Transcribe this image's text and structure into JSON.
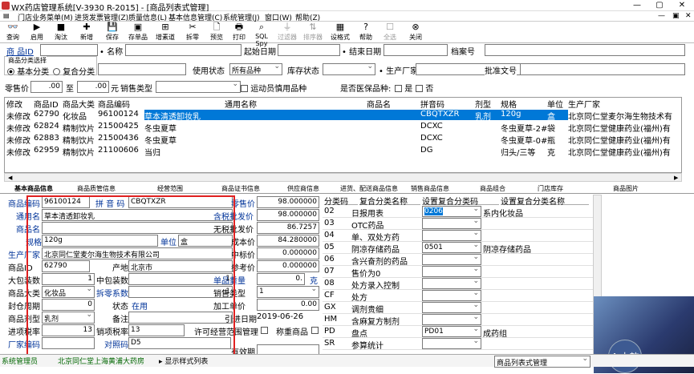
{
  "window": {
    "title": "WX药店管理系统[V-3930 R-2015] - [商品列表式管理]",
    "controls": [
      "—",
      "▢",
      "✕"
    ]
  },
  "menu": [
    "门店业务菜单(M)",
    "进货发票管理(Z)",
    "质量信息(L)",
    "基本信息管理(C)",
    "系统管理(J)",
    "窗口(W)",
    "帮助(Z)"
  ],
  "toolbar": [
    {
      "label": "查询",
      "icon": "binoculars-icon",
      "glyph": "👓",
      "enabled": true
    },
    {
      "label": "启用",
      "icon": "play-icon",
      "glyph": "▶",
      "enabled": true
    },
    {
      "label": "淘汰",
      "icon": "stop-icon",
      "glyph": "■",
      "enabled": true
    },
    {
      "label": "新增",
      "icon": "add-icon",
      "glyph": "✚",
      "enabled": true
    },
    {
      "label": "保存",
      "icon": "save-icon",
      "glyph": "💾",
      "enabled": true
    },
    {
      "label": "存单品",
      "icon": "save-item-icon",
      "glyph": "▣",
      "enabled": true
    },
    {
      "label": "增素道",
      "icon": "add-channel-icon",
      "glyph": "⊞",
      "enabled": true
    },
    {
      "label": "拆零",
      "icon": "split-icon",
      "glyph": "✂",
      "enabled": true
    },
    {
      "label": "预览",
      "icon": "preview-icon",
      "glyph": "🗋",
      "enabled": true
    },
    {
      "label": "打印",
      "icon": "print-icon",
      "glyph": "🖶",
      "enabled": true
    },
    {
      "label": "SQL Spy",
      "icon": "sql-icon",
      "glyph": "⌕",
      "enabled": true
    },
    {
      "label": "过滤器",
      "icon": "filter-icon",
      "glyph": "⏚",
      "enabled": false
    },
    {
      "label": "排序器",
      "icon": "sort-icon",
      "glyph": "⇅",
      "enabled": false
    },
    {
      "label": "设格式",
      "icon": "format-icon",
      "glyph": "▦",
      "enabled": true
    },
    {
      "label": "帮助",
      "icon": "help-icon",
      "glyph": "?",
      "enabled": true
    },
    {
      "label": "全选",
      "icon": "select-all-icon",
      "glyph": "☐",
      "enabled": false
    },
    {
      "label": "关闭",
      "icon": "close-icon",
      "glyph": "⊗",
      "enabled": true
    }
  ],
  "filters": {
    "product_id_label": "商  品ID",
    "name_label": "名称",
    "start_date_label": "起始日期",
    "end_date_label": "结束日期",
    "archive_label": "档案号",
    "category_group_label": "商品分类选择",
    "basic_cat_label": "基本分类",
    "compound_cat_label": "复合分类",
    "use_status_label": "使用状态",
    "use_status_value": "所有品种",
    "stock_status_label": "库存状态",
    "manufacturer_label": "生产厂家",
    "approval_label": "批准文号",
    "retail_label": "零售价",
    "retail_from": ".00",
    "to_label": "至",
    "retail_to": ".00",
    "yuan_label": "元",
    "sales_type_label": "销售类型",
    "athlete_label": "运动员慎用品种",
    "medicare_label": "是否医保品种:",
    "yes_label": "是",
    "no_label": "否"
  },
  "grid": {
    "headers": [
      "修改",
      "商品ID",
      "商品大类",
      "商品编码",
      "通用名称",
      "商品名",
      "拼音码",
      "剂型",
      "规格",
      "单位",
      "生产厂家"
    ],
    "rows": [
      [
        "未修改",
        "62790",
        "化妆品",
        "96100124",
        "草本清透卸妆乳",
        "",
        "CBQTXZR",
        "乳剂",
        "120g",
        "盒",
        "北京同仁堂麦尔海生物技术有"
      ],
      [
        "未修改",
        "62824",
        "精制饮片",
        "21500425",
        "冬虫夏草",
        "",
        "DCXC",
        "",
        "冬虫夏草-2#",
        "袋",
        "北京同仁堂健康药业(福州)有"
      ],
      [
        "未修改",
        "62883",
        "精制饮片",
        "21500436",
        "冬虫夏草",
        "",
        "DCXC",
        "",
        "冬虫夏草-0#-",
        "瓶",
        "北京同仁堂健康药业(福州)有"
      ],
      [
        "未修改",
        "62959",
        "精制饮片",
        "21100606",
        "当归",
        "",
        "DG",
        "",
        "归头/三等",
        "克",
        "北京同仁堂健康药业(福州)有"
      ]
    ]
  },
  "tabs": [
    "基本商品信息",
    "商品质管信息",
    "经营范围",
    "商品证书信息",
    "供应商信息",
    "进货、配送商品信息",
    "销售商品信息",
    "商品组合",
    "门店库存",
    "商品图片"
  ],
  "basic": {
    "code_label": "商品编码",
    "code": "96100124",
    "pinyin_label": "拼 音 码",
    "pinyin": "CBQTXZR",
    "generic_label": "通用名",
    "generic": "草本清透卸妆乳",
    "trade_label": "商品名",
    "trade": "",
    "spec_label": "规格",
    "spec": "120g",
    "unit_label": "单位",
    "unit": "盒",
    "mfr_label": "生产厂家",
    "mfr": "北京同仁堂麦尔海生物技术有限公司",
    "id_label": "商品ID",
    "id": "62790",
    "origin_label": "产地",
    "origin": "北京市",
    "big_pack_label": "大包装数",
    "big_pack": "1",
    "mid_pack_label": "中包装数",
    "mid_pack": "1",
    "cat_label": "商品大类",
    "cat": "化妆品",
    "split_label": "拆零系数",
    "split": "1",
    "seal_label": "封仓周期",
    "seal": "0",
    "status_label": "状态",
    "status": "在用",
    "form_label": "商品剂型",
    "form": "乳剂",
    "remark_label": "备注",
    "remark": "",
    "in_tax_label": "进项税率",
    "in_tax": "13",
    "out_tax_label": "销项税率",
    "out_tax": "13",
    "mfr_code_label": "厂家编码",
    "mfr_code": "",
    "ref_code_label": "对照码",
    "ref_code": "D5",
    "price_labels": {
      "retail": "零售价",
      "tax_in": "含税批发价",
      "notax": "无税批发价",
      "cost": "成本价",
      "mid": "中标价",
      "ref": "参考价",
      "weight": "单品重量",
      "sale_type": "销售类型",
      "add": "加工单价",
      "intro": "引进日期",
      "expiry": "有效期",
      "license": "许可经营范围管理",
      "weigh": "称重商品"
    },
    "prices": {
      "retail": "98.000000",
      "tax_in": "98.000000",
      "notax": "86.7257",
      "cost": "84.280000",
      "mid": "0.000000",
      "ref": "0.000000",
      "weight": "0.",
      "weight_unit": "克",
      "sale_type": "1",
      "add": "0.00",
      "intro": "2019-06-26",
      "expiry": ""
    }
  },
  "compound": {
    "headers": [
      "分类码",
      "复合分类名称",
      "设置复合分类码",
      "设置复合分类名称"
    ],
    "rows": [
      [
        "02",
        "日报用表",
        "0206",
        "系内化妆品"
      ],
      [
        "03",
        "OTC药品",
        "",
        ""
      ],
      [
        "04",
        "单、双处方药",
        "",
        ""
      ],
      [
        "05",
        "阴凉存储药品",
        "0501",
        "阴凉存储药品"
      ],
      [
        "06",
        "含兴奋剂的药品",
        "",
        ""
      ],
      [
        "07",
        "售价为0",
        "",
        ""
      ],
      [
        "08",
        "处方录入控制",
        "",
        ""
      ],
      [
        "CF",
        "处方",
        "",
        ""
      ],
      [
        "GX",
        "调剂贵细",
        "",
        ""
      ],
      [
        "HM",
        "含麻复方制剂",
        "",
        ""
      ],
      [
        "PD",
        "盘点",
        "PD01",
        "成药组"
      ],
      [
        "SR",
        "参算统计",
        "",
        ""
      ]
    ]
  },
  "status_bar": {
    "left": "系统管理员",
    "store": "北京同仁堂上海黄浦大药房",
    "display": "显示样式列表",
    "right_combo": "商品列表式管理",
    "num": "4",
    "badge": "中韵"
  }
}
